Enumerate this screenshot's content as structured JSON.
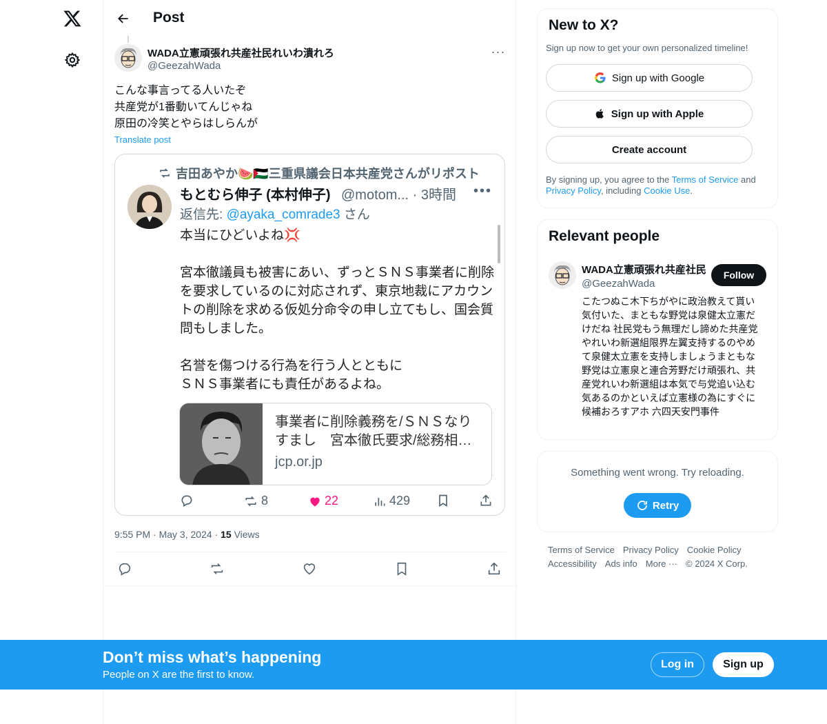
{
  "colors": {
    "accent": "#1d9bf0",
    "like": "#f91880",
    "text": "#0f1419",
    "muted": "#536471"
  },
  "nav": {
    "logo_icon": "x-logo-icon",
    "settings_icon": "gear-icon"
  },
  "header": {
    "title": "Post"
  },
  "post": {
    "author_name": "WADA立憲頑張れ共産社民れいわ潰れろ",
    "author_handle": "@GeezahWada",
    "text": "こんな事言ってる人いたぞ\n共産党が1番動いてんじゃね\n原田の冷笑とやらはしらんが",
    "translate": "Translate post",
    "time": "9:55 PM",
    "date": "May 3, 2024",
    "views_count": "15",
    "views_label": "Views",
    "more": "···"
  },
  "embed": {
    "repost_line": "吉田あやか🍉🇵🇸三重県議会日本共産党さんがリポスト",
    "name": "もとむら伸子 (本村伸子)",
    "handle_time": "@motom... · 3時間",
    "dots": "•••",
    "reply_prefix": "返信先: ",
    "reply_mention": "@ayaka_comrade3",
    "reply_suffix": " さん",
    "body": "本当にひどいよね💢\n\n宮本徹議員も被害にあい、ずっとＳＮＳ事業者に削除を要求しているのに対応されず、東京地裁にアカウントの削除を求める仮処分命令の申し立てもし、国会質問もしました。\n\n名誉を傷つける行為を行う人とともに\nＳＮＳ事業者にも責任があるよね。",
    "card_title": "事業者に削除義務を/ＳＮＳなりすまし　宮本徹氏要求/総務相…",
    "card_domain": "jcp.or.jp",
    "retweets": "8",
    "likes": "22",
    "views": "429"
  },
  "sidebar": {
    "new_title": "New to X?",
    "new_sub": "Sign up now to get your own personalized timeline!",
    "google": "Sign up with Google",
    "apple": "Sign up with Apple",
    "create": "Create account",
    "terms_pre": "By signing up, you agree to the ",
    "terms_tos": "Terms of Service",
    "terms_and": " and ",
    "terms_pp": "Privacy Policy",
    "terms_inc": ", including ",
    "terms_cookie": "Cookie Use",
    "terms_end": ".",
    "relevant_title": "Relevant people",
    "rel_name": "WADA立憲頑張れ共産社民れいわ潰れろ",
    "rel_handle": "@GeezahWada",
    "follow": "Follow",
    "rel_bio": "こたつぬこ木下ちがやに政治教えて貰い気付いた、まともな野党は泉健太立憲だけだね 社民党もう無理だし諦めた共産党やれいわ新選組限界左翼支持するのやめて泉健太立憲を支持しましょうまともな野党は立憲泉と連合芳野だけ頑張れ、共産党れいわ新選組は本気で与党追い込む気あるのかといえば立憲様の為にすぐに候補おろすアホ 六四天安門事件",
    "error_text": "Something went wrong. Try reloading.",
    "retry": "Retry"
  },
  "footer": {
    "links": [
      "Terms of Service",
      "Privacy Policy",
      "Cookie Policy",
      "Accessibility",
      "Ads info",
      "More ···",
      "© 2024 X Corp."
    ]
  },
  "banner": {
    "title": "Don’t miss what’s happening",
    "sub": "People on X are the first to know.",
    "login": "Log in",
    "signup": "Sign up"
  }
}
